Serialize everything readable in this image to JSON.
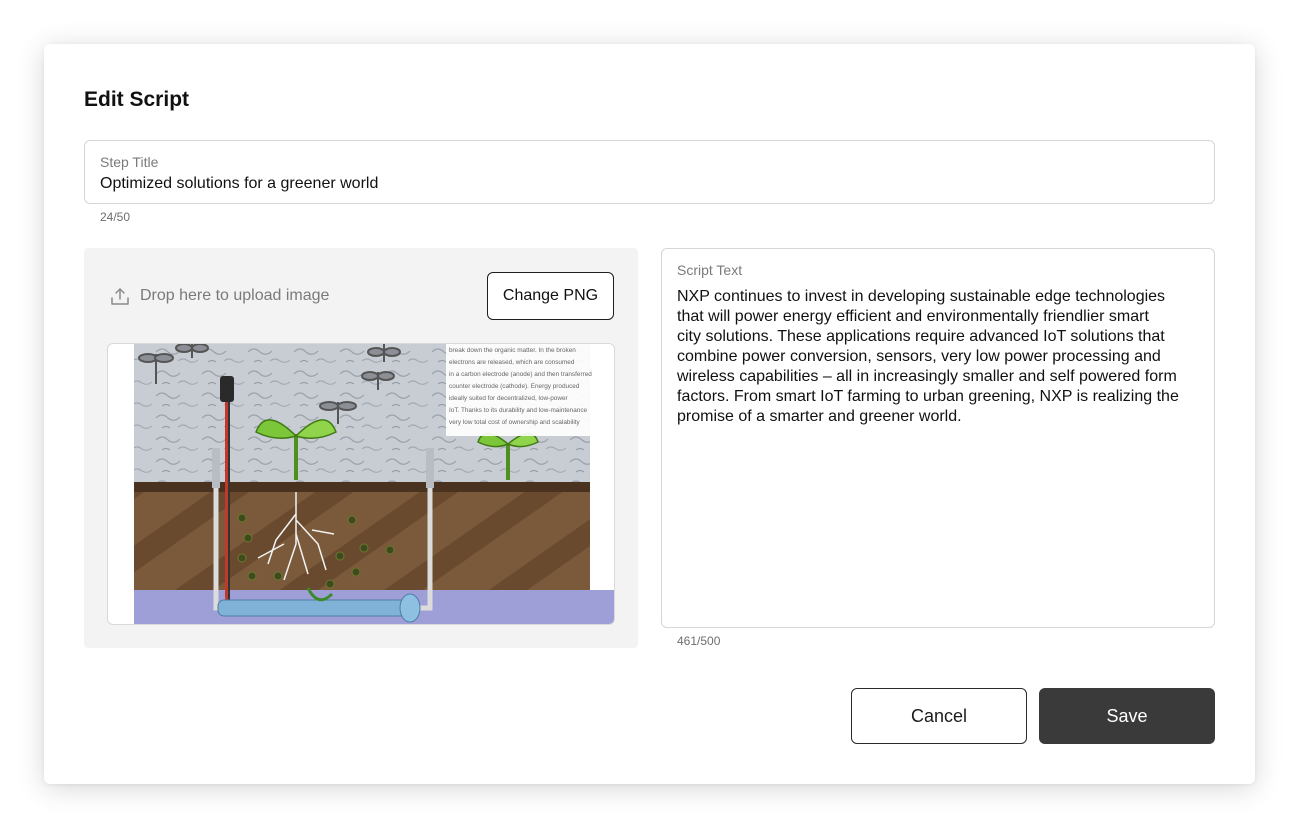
{
  "dialog": {
    "title": "Edit Script"
  },
  "step_title": {
    "label": "Step Title",
    "value": "Optimized solutions for a greener world",
    "counter": "24/50"
  },
  "upload": {
    "drop_label": "Drop here to upload image",
    "change_button_label": "Change PNG",
    "icon": "upload-icon",
    "image_caption_lines": [
      "break down the organic matter. In the broken",
      "electrons are released, which are consumed",
      "in a carbon electrode (anode) and then transferred",
      "counter electrode (cathode). Energy produced",
      "ideally suited for decentralized, low-power",
      "IoT. Thanks to its durability and low-maintenance",
      "very low total cost of ownership and scalability"
    ]
  },
  "script": {
    "label": "Script Text",
    "lines": [
      "NXP continues to invest in developing sustainable edge technologies",
      "that will power energy efficient and environmentally friendlier smart",
      "city solutions. These applications require advanced IoT solutions that",
      "combine power conversion, sensors, very low power processing and",
      "wireless capabilities – all in increasingly smaller and self powered form",
      "factors. From smart IoT farming to urban greening, NXP is realizing the",
      "promise of a smarter and greener world."
    ],
    "counter": "461/500"
  },
  "actions": {
    "cancel_label": "Cancel",
    "save_label": "Save"
  },
  "colors": {
    "primary_button": "#3a3a3a",
    "panel_background": "#f3f3f3",
    "border": "#d6d6d6"
  }
}
